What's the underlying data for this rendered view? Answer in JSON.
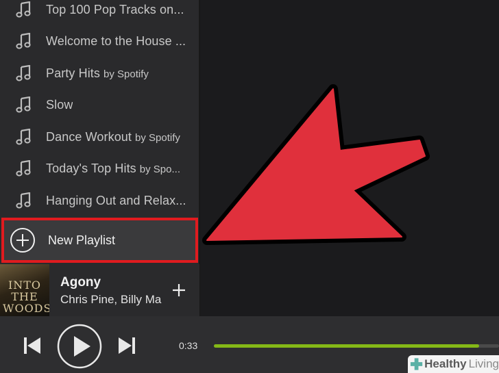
{
  "sidebar": {
    "playlists": [
      {
        "name": "Top 100 Pop Tracks on...",
        "owner": ""
      },
      {
        "name": "Welcome to the House ...",
        "owner": ""
      },
      {
        "name": "Party Hits",
        "owner": "by Spotify"
      },
      {
        "name": "Slow",
        "owner": ""
      },
      {
        "name": "Dance Workout",
        "owner": "by Spotify"
      },
      {
        "name": "Today's Top Hits",
        "owner": "by Spo..."
      },
      {
        "name": "Hanging Out and Relax...",
        "owner": ""
      }
    ],
    "new_playlist_label": "New Playlist"
  },
  "now_playing": {
    "cover_art_text": "INTO THE WOODS",
    "title": "Agony",
    "artist": "Chris Pine, Billy Ma"
  },
  "player": {
    "elapsed": "0:33",
    "progress_fraction": 0.93
  },
  "watermark": {
    "brand_bold": "Healthy",
    "brand_light": "Living"
  },
  "colors": {
    "highlight_border": "#e01b1f",
    "arrow_fill": "#e0303c",
    "progress": "#84b817"
  },
  "icons": {
    "playlist": "music-note-icon",
    "new_playlist": "plus-circle-icon",
    "add": "plus-icon",
    "prev": "skip-previous-icon",
    "play": "play-icon",
    "next": "skip-next-icon"
  }
}
